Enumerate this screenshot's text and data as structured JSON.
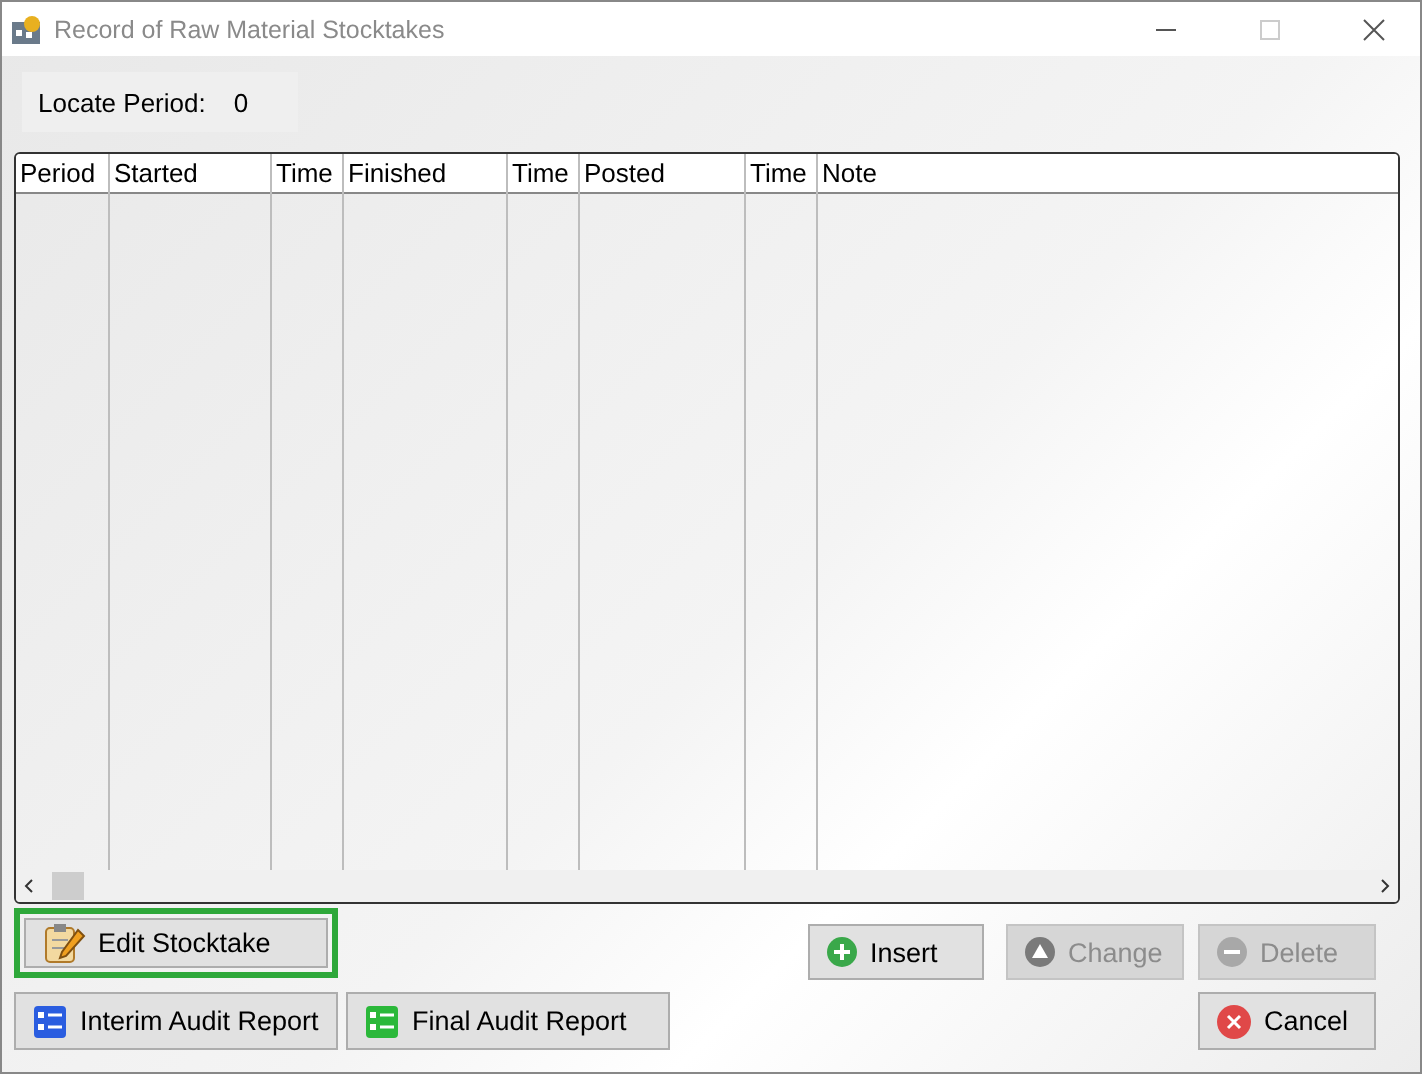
{
  "window": {
    "title": "Record of Raw Material Stocktakes"
  },
  "locate": {
    "label": "Locate Period:",
    "value": "0"
  },
  "table": {
    "columns": [
      {
        "label": "Period"
      },
      {
        "label": "Started"
      },
      {
        "label": "Time"
      },
      {
        "label": "Finished"
      },
      {
        "label": "Time"
      },
      {
        "label": "Posted"
      },
      {
        "label": "Time"
      },
      {
        "label": "Note"
      }
    ]
  },
  "buttons": [
    {
      "label": "Edit Stocktake",
      "kind": "edit",
      "disabled": false,
      "focused": true
    },
    {
      "label": "Insert",
      "kind": "insert",
      "disabled": false,
      "focused": false
    },
    {
      "label": "Change",
      "kind": "change",
      "disabled": true,
      "focused": false
    },
    {
      "label": "Delete",
      "kind": "delete",
      "disabled": true,
      "focused": false
    },
    {
      "label": "Interim Audit Report",
      "kind": "interim",
      "disabled": false,
      "focused": false
    },
    {
      "label": "Final Audit Report",
      "kind": "final",
      "disabled": false,
      "focused": false
    },
    {
      "label": "Cancel",
      "kind": "cancel",
      "disabled": false,
      "focused": false
    }
  ]
}
